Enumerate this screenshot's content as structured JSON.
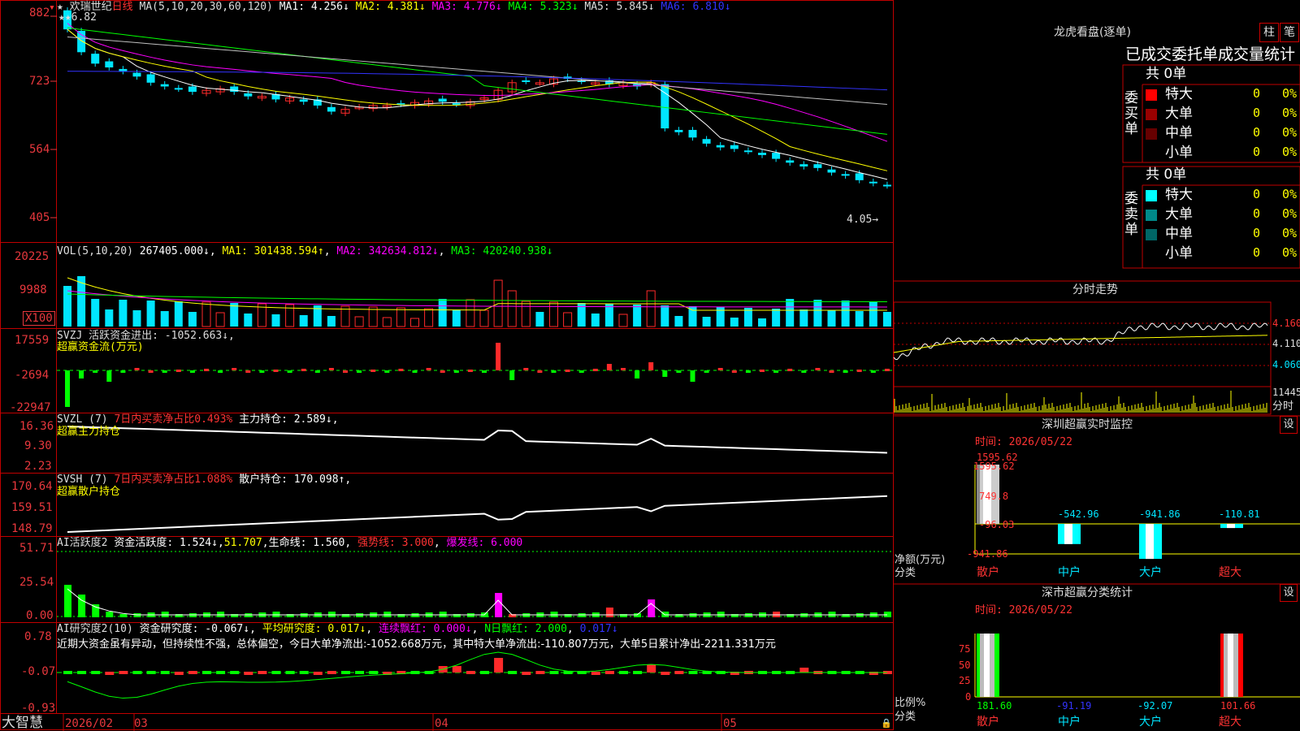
{
  "colors": {
    "up": "#ff2a2a",
    "down": "#00e5ff",
    "ma1": "#ffffff",
    "ma2": "#ffff00",
    "ma3": "#ff00ff",
    "ma4": "#00ff00",
    "ma5": "#c0c0c0",
    "ma6": "#3333ff",
    "grid": "#c00000",
    "panel_border": "#c00000",
    "green": "#00ff00",
    "cyan": "#00ffff",
    "magenta": "#ff00ff",
    "axis": "#e8383d"
  },
  "kline": {
    "stock_name": "欢瑞世纪",
    "period": "日线",
    "ma_label": "MA(5,10,20,30,60,120)",
    "ma1": "MA1: 4.256↓",
    "ma2": "MA2: 4.381↓",
    "ma3": "MA3: 4.776↓",
    "ma4": "MA4: 5.323↓",
    "ma5": "MA5: 5.845↓",
    "ma6": "MA6: 6.810↓",
    "y_ticks": [
      "882",
      "723",
      "564",
      "405"
    ],
    "high_label": "★★6.82",
    "last_label": "4.05→"
  },
  "vol": {
    "label": "VOL(5,10,20)",
    "value": "267405.000↓",
    "ma1": "MA1: 301438.594↑",
    "ma2": "MA2: 342634.812↓",
    "ma3": "MA3: 420240.938↓",
    "y_ticks": [
      "20225",
      "9988",
      "X100"
    ]
  },
  "svzj": {
    "label": "SVZJ  活跃资金进出: -1052.663↓,",
    "sub": "超赢资金流(万元)",
    "y_ticks": [
      "17559",
      "-2694",
      "-22947"
    ]
  },
  "svzl": {
    "label": "SVZL (7)",
    "mid": "7日内买卖净占比0.493%",
    "main": "主力持仓: 2.589↓,",
    "sub": "超赢主力持仓",
    "y_ticks": [
      "16.36",
      "9.30",
      "2.23"
    ]
  },
  "svsh": {
    "label": "SVSH (7)",
    "mid": "7日内买卖净占比1.088%",
    "main": "散户持仓: 170.098↑,",
    "sub": "超赢散户持仓",
    "y_ticks": [
      "170.64",
      "159.51",
      "148.79"
    ]
  },
  "ai1": {
    "label": "AI活跃度2",
    "a": "资金活跃度: 1.524↓",
    "b": "51.707",
    "c": "生命线: 1.560",
    "d": "强势线: 3.000",
    "e": "爆发线: 6.000",
    "y_ticks": [
      "51.71",
      "25.54",
      "0.00"
    ]
  },
  "ai2": {
    "label": "AI研究度2(10)",
    "a": "资金研究度: -0.067↓",
    "b": "平均研究度: 0.017↓",
    "c": "连续飘红: 0.000↓",
    "d": "N日飘红: 2.000",
    "e": "0.017↓",
    "comment": "近期大资金虽有异动，但持续性不强，总体偏空，今日大单净流出:-1052.668万元，其中特大单净流出:-110.807万元，大单5日累计净出-2211.331万元",
    "y_ticks": [
      "0.78",
      "-0.07",
      "-0.93"
    ]
  },
  "xaxis": {
    "corner": "大智慧",
    "dates": [
      "2026/02",
      "03",
      "04",
      "05"
    ]
  },
  "right": {
    "lhb_title": "龙虎看盘(逐单)",
    "btn_zhu": "柱",
    "btn_bi": "笔",
    "stat_title": "已成交委托单成交量统计",
    "buy": {
      "side": "委买单",
      "total": "共 0单",
      "rows": [
        {
          "name": "特大",
          "count": "0",
          "pct": "0%"
        },
        {
          "name": "大单",
          "count": "0",
          "pct": "0%"
        },
        {
          "name": "中单",
          "count": "0",
          "pct": "0%"
        },
        {
          "name": "小单",
          "count": "0",
          "pct": "0%"
        }
      ]
    },
    "sell": {
      "side": "委卖单",
      "total": "共 0单",
      "rows": [
        {
          "name": "特大",
          "count": "0",
          "pct": "0%"
        },
        {
          "name": "大单",
          "count": "0",
          "pct": "0%"
        },
        {
          "name": "中单",
          "count": "0",
          "pct": "0%"
        },
        {
          "name": "小单",
          "count": "0",
          "pct": "0%"
        }
      ]
    },
    "fs_title": "分时走势",
    "fs_prices": [
      "4.160",
      "4.110",
      "4.060"
    ],
    "fs_vol": "11445",
    "fs_unit": "分时",
    "sz_title": "深圳超赢实时监控",
    "sz_time": "时间: 2026/05/22",
    "sz_set": "设",
    "sz_y": [
      "1595.62",
      "749.8",
      "-96.03",
      "-941.86"
    ],
    "sz_bars": [
      {
        "cat": "散户",
        "val": 1595.62,
        "label": "1595.62"
      },
      {
        "cat": "中户",
        "val": -542.96,
        "label": "-542.96"
      },
      {
        "cat": "大户",
        "val": -941.86,
        "label": "-941.86"
      },
      {
        "cat": "超大",
        "val": -110.81,
        "label": "-110.81"
      }
    ],
    "sz_ylabel": "净额(万元)",
    "sz_xlabel": "分类",
    "ss_title": "深市超赢分类统计",
    "ss_time": "时间: 2026/05/22",
    "ss_set": "设",
    "ss_y": [
      "75",
      "50",
      "25",
      "0"
    ],
    "ss_bars": [
      {
        "cat": "散户",
        "val": 181.6,
        "label": "181.60"
      },
      {
        "cat": "中户",
        "val": -91.19,
        "label": "-91.19"
      },
      {
        "cat": "大户",
        "val": -92.07,
        "label": "-92.07"
      },
      {
        "cat": "超大",
        "val": 101.66,
        "label": "101.66"
      }
    ],
    "ss_ylabel": "比例%",
    "ss_xlabel": "分类"
  }
}
